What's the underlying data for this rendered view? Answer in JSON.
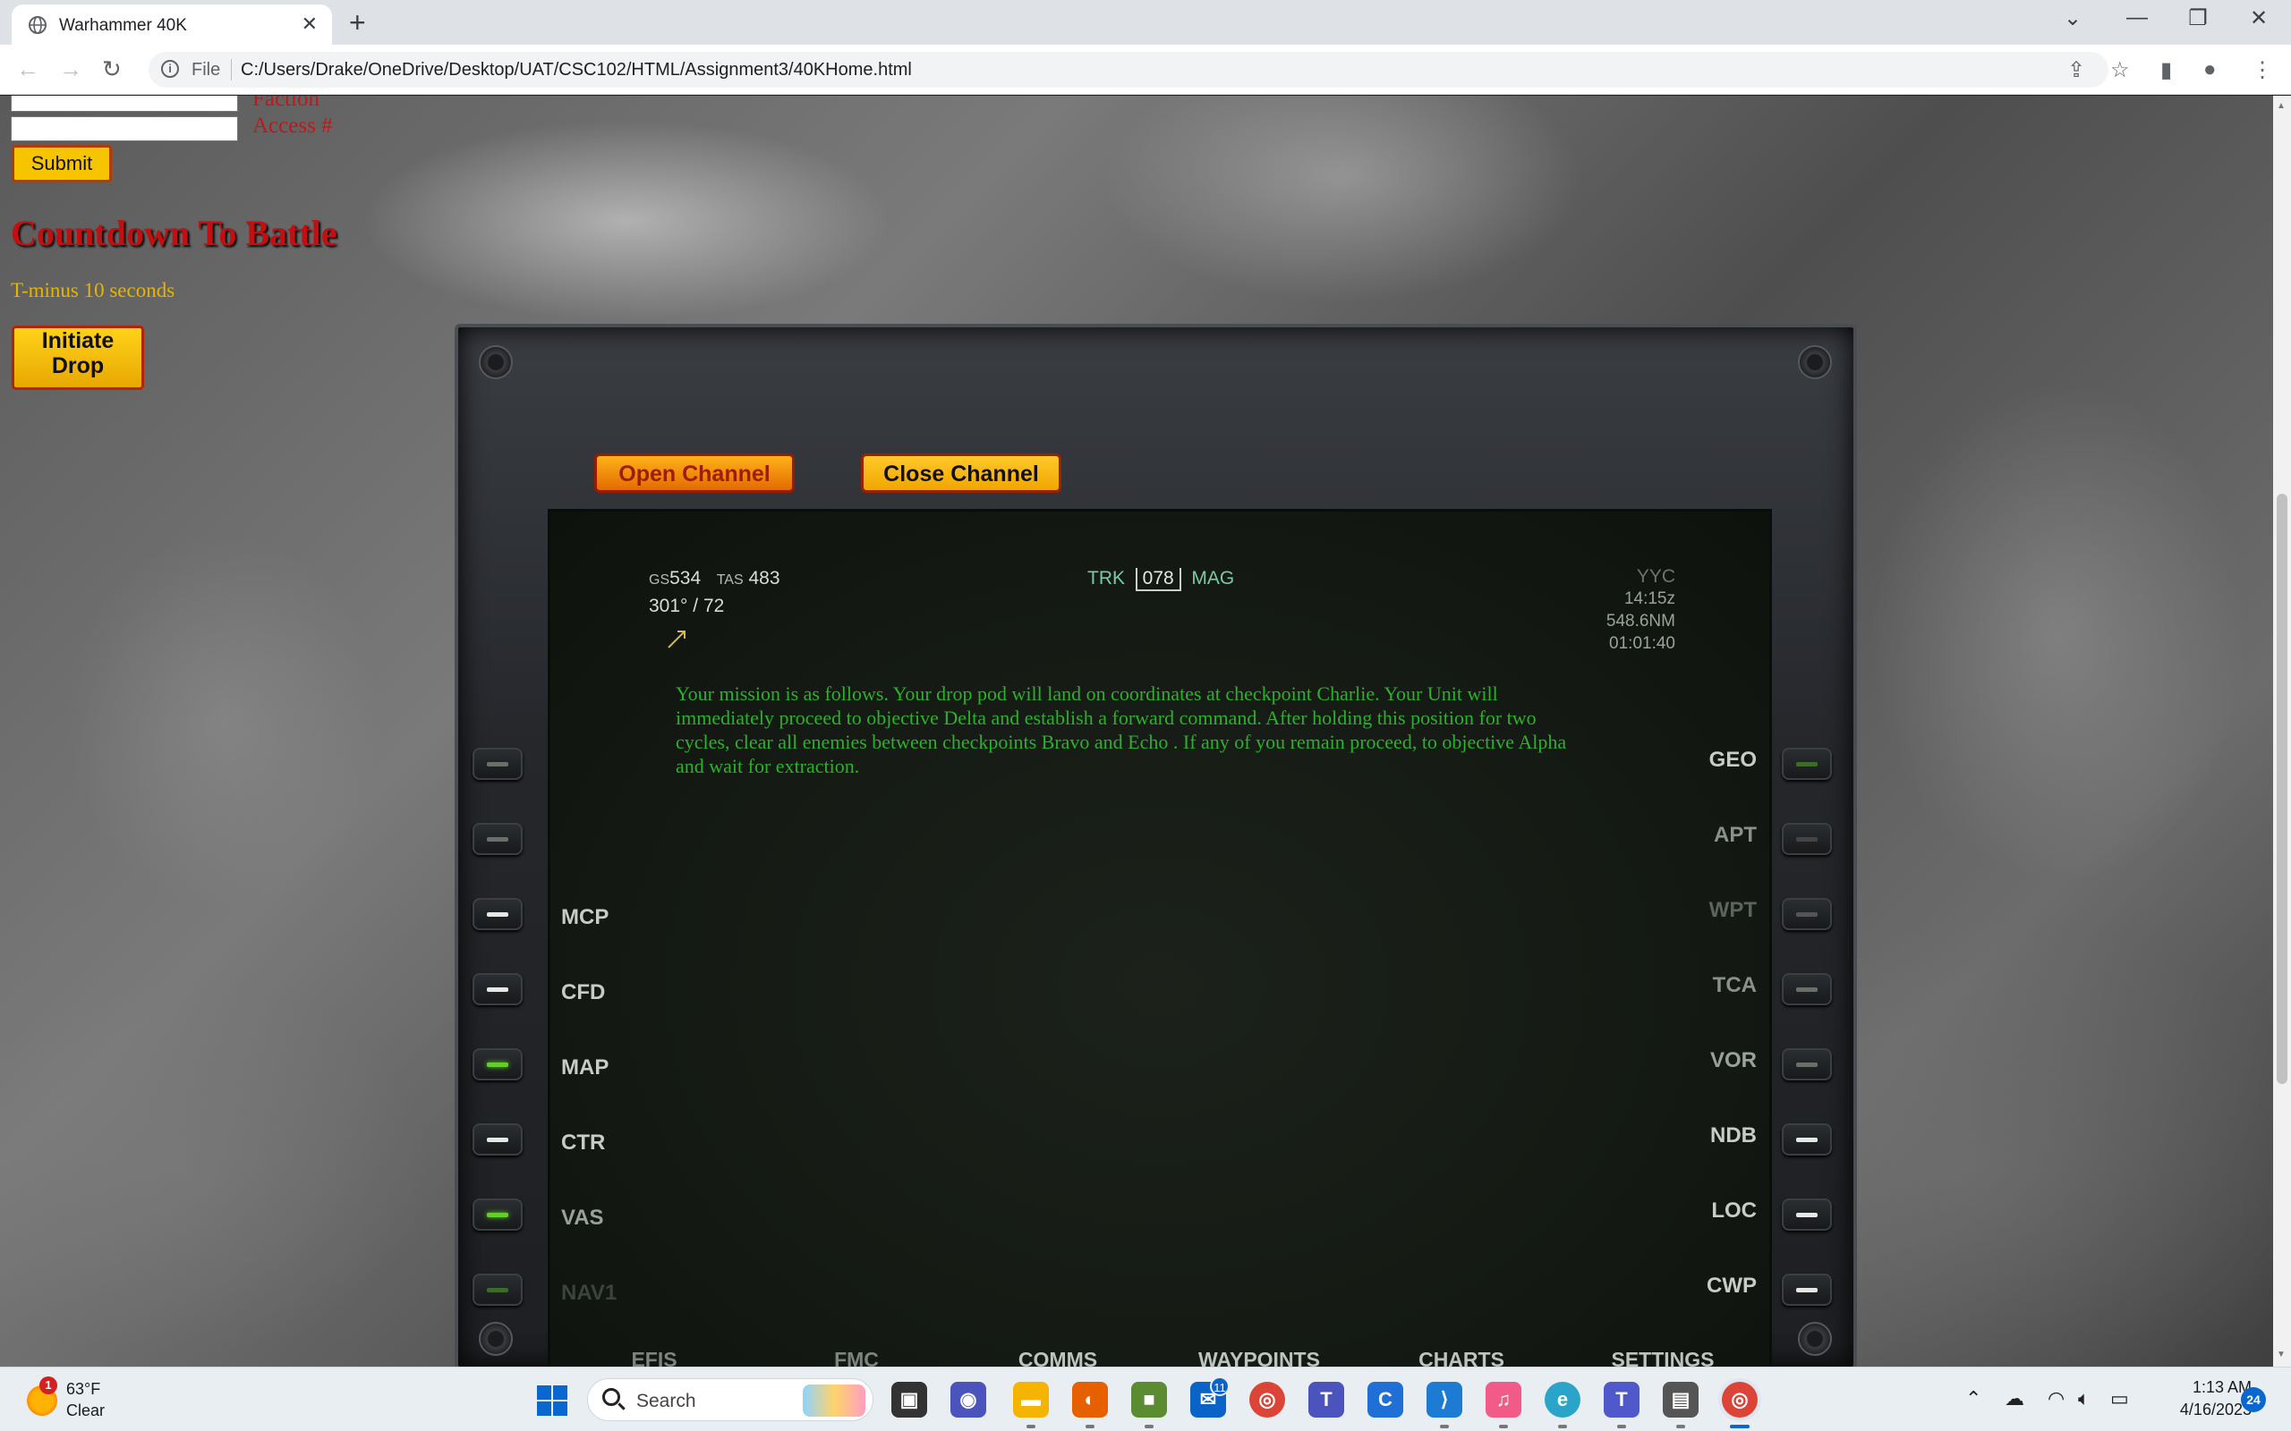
{
  "browser": {
    "tab_title": "Warhammer 40K",
    "url_scheme": "File",
    "url": "C:/Users/Drake/OneDrive/Desktop/UAT/CSC102/HTML/Assignment3/40KHome.html"
  },
  "page": {
    "form": {
      "faction_label": "Faction",
      "access_label": "Access #",
      "submit_label": "Submit"
    },
    "countdown_title": "Countdown To Battle",
    "countdown_text": "T-minus 10 seconds",
    "initiate_label_1": "Initiate",
    "initiate_label_2": "Drop"
  },
  "display": {
    "open_channel": "Open Channel",
    "close_channel": "Close Channel",
    "gs_label": "GS",
    "gs_value": "534",
    "tas_label": "TAS",
    "tas_value": "483",
    "wind": "301° / 72",
    "trk_label": "TRK",
    "trk_value": "078",
    "mag_label": "MAG",
    "dest": "YYC",
    "time_z": "14:15z",
    "distance": "548.6NM",
    "ete": "01:01:40",
    "mission": "Your mission is as follows. Your drop pod will land on coordinates at checkpoint Charlie. Your Unit will immediately proceed to objective Delta and establish a forward command. After holding this position for two cycles, clear all enemies between checkpoints Bravo and Echo . If any of you remain proceed, to objective Alpha and wait for extraction.",
    "left_labels": [
      "MCP",
      "CFD",
      "MAP",
      "CTR",
      "VAS",
      "NAV1"
    ],
    "right_labels": [
      "GEO",
      "APT",
      "WPT",
      "TCA",
      "VOR",
      "NDB",
      "LOC",
      "CWP"
    ],
    "bottom_labels": [
      "EFIS",
      "FMC",
      "COMMS",
      "WAYPOINTS",
      "CHARTS",
      "SETTINGS"
    ]
  },
  "taskbar": {
    "weather_temp": "63°F",
    "weather_desc": "Clear",
    "weather_badge": "1",
    "search_label": "Search",
    "mail_badge": "11",
    "time": "1:13 AM",
    "date": "4/16/2023",
    "notifications": "24"
  }
}
